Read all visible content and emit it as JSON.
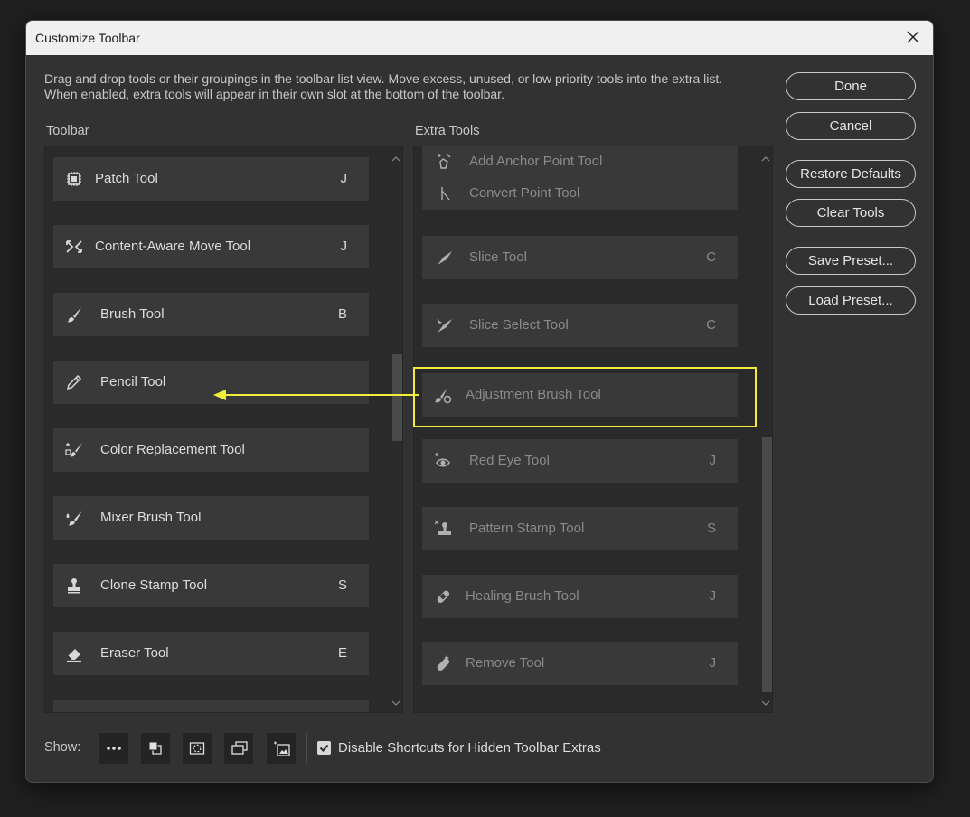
{
  "dialog": {
    "title": "Customize Toolbar",
    "description": "Drag and drop tools or their groupings in the toolbar list view. Move excess, unused, or low priority tools into the extra list. When enabled, extra tools will appear in their own slot at the bottom of the toolbar."
  },
  "toolbar": {
    "label": "Toolbar",
    "items": [
      {
        "name": "Patch Tool",
        "key": "J",
        "icon": "patch-icon"
      },
      {
        "name": "Content-Aware Move Tool",
        "key": "J",
        "icon": "content-aware-move-icon"
      },
      {
        "name": "Brush Tool",
        "key": "B",
        "icon": "brush-icon"
      },
      {
        "name": "Pencil Tool",
        "key": "",
        "icon": "pencil-icon"
      },
      {
        "name": "Color Replacement Tool",
        "key": "",
        "icon": "color-replacement-icon"
      },
      {
        "name": "Mixer Brush Tool",
        "key": "",
        "icon": "mixer-brush-icon"
      },
      {
        "name": "Clone Stamp Tool",
        "key": "S",
        "icon": "clone-stamp-icon"
      },
      {
        "name": "Eraser Tool",
        "key": "E",
        "icon": "eraser-icon"
      }
    ]
  },
  "extra": {
    "label": "Extra Tools",
    "group": [
      {
        "name": "Add Anchor Point Tool",
        "icon": "add-anchor-point-icon"
      },
      {
        "name": "Convert Point Tool",
        "icon": "convert-point-icon"
      }
    ],
    "items": [
      {
        "name": "Slice Tool",
        "key": "C",
        "icon": "slice-icon"
      },
      {
        "name": "Slice Select Tool",
        "key": "C",
        "icon": "slice-select-icon"
      },
      {
        "name": "Adjustment Brush Tool",
        "key": "",
        "icon": "adjustment-brush-icon"
      },
      {
        "name": "Red Eye Tool",
        "key": "J",
        "icon": "red-eye-icon"
      },
      {
        "name": "Pattern Stamp Tool",
        "key": "S",
        "icon": "pattern-stamp-icon"
      },
      {
        "name": "Healing Brush Tool",
        "key": "J",
        "icon": "healing-brush-icon"
      },
      {
        "name": "Remove Tool",
        "key": "J",
        "icon": "remove-icon"
      }
    ]
  },
  "buttons": {
    "done": "Done",
    "cancel": "Cancel",
    "restore": "Restore Defaults",
    "clear": "Clear Tools",
    "save": "Save Preset...",
    "load": "Load Preset..."
  },
  "footer": {
    "show_label": "Show:",
    "checkbox_label": "Disable Shortcuts for Hidden Toolbar Extras",
    "checkbox_checked": true
  },
  "colors": {
    "highlight": "#f2ec3a",
    "dialog_bg": "#323232",
    "item_bg": "#393939"
  }
}
